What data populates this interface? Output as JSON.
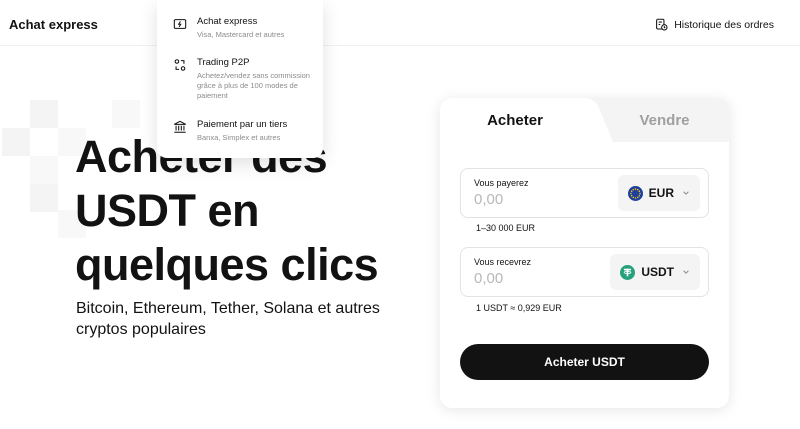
{
  "header": {
    "brand": "Achat express",
    "history_label": "Historique des ordres"
  },
  "menu": {
    "items": [
      {
        "icon": "card-icon",
        "title": "Achat express",
        "desc": "Visa, Mastercard et autres"
      },
      {
        "icon": "p2p-exchange-icon",
        "title": "Trading P2P",
        "desc": "Achetez/vendez sans commission grâce à plus de 100 modes de paiement"
      },
      {
        "icon": "bank-icon",
        "title": "Paiement par un tiers",
        "desc": "Banxa, Simplex et autres"
      }
    ]
  },
  "hero": {
    "title": "Acheter des USDT en quelques clics",
    "subtitle": "Bitcoin, Ethereum, Tether, Solana et autres cryptos populaires"
  },
  "card": {
    "tabs": {
      "buy": "Acheter",
      "sell": "Vendre"
    },
    "pay": {
      "label": "Vous payerez",
      "placeholder": "0,00",
      "currency": "EUR",
      "currency_icon": "eu-flag-icon",
      "currency_color": "#1f3f9e",
      "limit": "1–30 000 EUR"
    },
    "receive": {
      "label": "Vous recevrez",
      "placeholder": "0,00",
      "currency": "USDT",
      "currency_icon": "tether-icon",
      "currency_color": "#26a17b",
      "rate": "1 USDT ≈ 0,929 EUR"
    },
    "cta_label": "Acheter USDT"
  },
  "colors": {
    "primary": "#121212",
    "muted": "#a0a0a0",
    "panel": "#f4f4f4"
  }
}
